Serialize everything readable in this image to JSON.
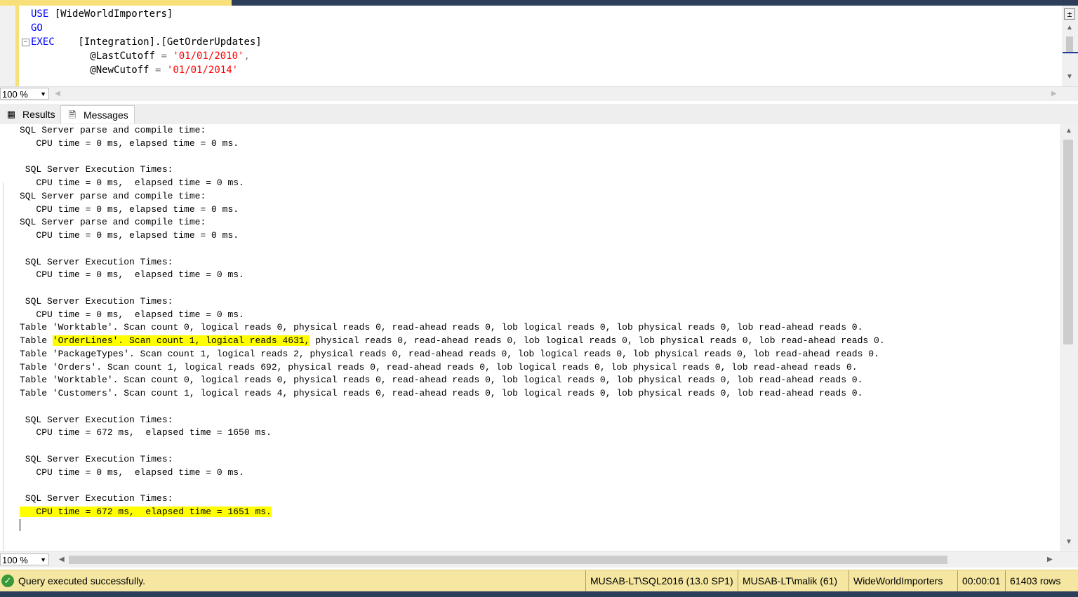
{
  "editor": {
    "lines": [
      {
        "kw": "USE",
        "rest": " [WideWorldImporters]"
      },
      {
        "kw": "GO",
        "rest": ""
      },
      {
        "kw": "EXEC",
        "rest": "    [Integration].[GetOrderUpdates]"
      }
    ],
    "param1_name": "@LastCutoff",
    "param1_value": "'01/01/2010'",
    "param2_name": "@NewCutoff",
    "param2_value": "'01/01/2014'"
  },
  "zoom": {
    "top": "100 %",
    "bottom": "100 %"
  },
  "tabs": {
    "results": "Results",
    "messages": "Messages"
  },
  "messages": {
    "block1": "SQL Server parse and compile time: \n   CPU time = 0 ms, elapsed time = 0 ms.\n\n SQL Server Execution Times:\n   CPU time = 0 ms,  elapsed time = 0 ms.\nSQL Server parse and compile time: \n   CPU time = 0 ms, elapsed time = 0 ms.\nSQL Server parse and compile time: \n   CPU time = 0 ms, elapsed time = 0 ms.\n\n SQL Server Execution Times:\n   CPU time = 0 ms,  elapsed time = 0 ms.\n\n SQL Server Execution Times:\n   CPU time = 0 ms,  elapsed time = 0 ms.\nTable 'Worktable'. Scan count 0, logical reads 0, physical reads 0, read-ahead reads 0, lob logical reads 0, lob physical reads 0, lob read-ahead reads 0.",
    "orderlines_prefix": "Table ",
    "orderlines_highlight": "'OrderLines'. Scan count 1, logical reads 4631,",
    "orderlines_suffix": " physical reads 0, read-ahead reads 0, lob logical reads 0, lob physical reads 0, lob read-ahead reads 0.",
    "block2": "Table 'PackageTypes'. Scan count 1, logical reads 2, physical reads 0, read-ahead reads 0, lob logical reads 0, lob physical reads 0, lob read-ahead reads 0.\nTable 'Orders'. Scan count 1, logical reads 692, physical reads 0, read-ahead reads 0, lob logical reads 0, lob physical reads 0, lob read-ahead reads 0.\nTable 'Worktable'. Scan count 0, logical reads 0, physical reads 0, read-ahead reads 0, lob logical reads 0, lob physical reads 0, lob read-ahead reads 0.\nTable 'Customers'. Scan count 1, logical reads 4, physical reads 0, read-ahead reads 0, lob logical reads 0, lob physical reads 0, lob read-ahead reads 0.\n\n SQL Server Execution Times:\n   CPU time = 672 ms,  elapsed time = 1650 ms.\n\n SQL Server Execution Times:\n   CPU time = 0 ms,  elapsed time = 0 ms.\n\n SQL Server Execution Times:",
    "final_highlight": "   CPU time = 672 ms,  elapsed time = 1651 ms."
  },
  "status": {
    "message": "Query executed successfully.",
    "server": "MUSAB-LT\\SQL2016 (13.0 SP1)",
    "user": "MUSAB-LT\\malik (61)",
    "database": "WideWorldImporters",
    "elapsed": "00:00:01",
    "rows": "61403 rows"
  },
  "colors": {
    "status_bg": "#f5e7a1",
    "highlight": "#ffff00",
    "keyword": "#0000ff",
    "string": "#ff0000"
  },
  "icons": [
    "grid-icon",
    "messages-icon",
    "success-check-icon",
    "dropdown-arrow-icon",
    "split-icon",
    "scroll-up-icon",
    "scroll-down-icon",
    "scroll-left-icon",
    "scroll-right-icon"
  ]
}
